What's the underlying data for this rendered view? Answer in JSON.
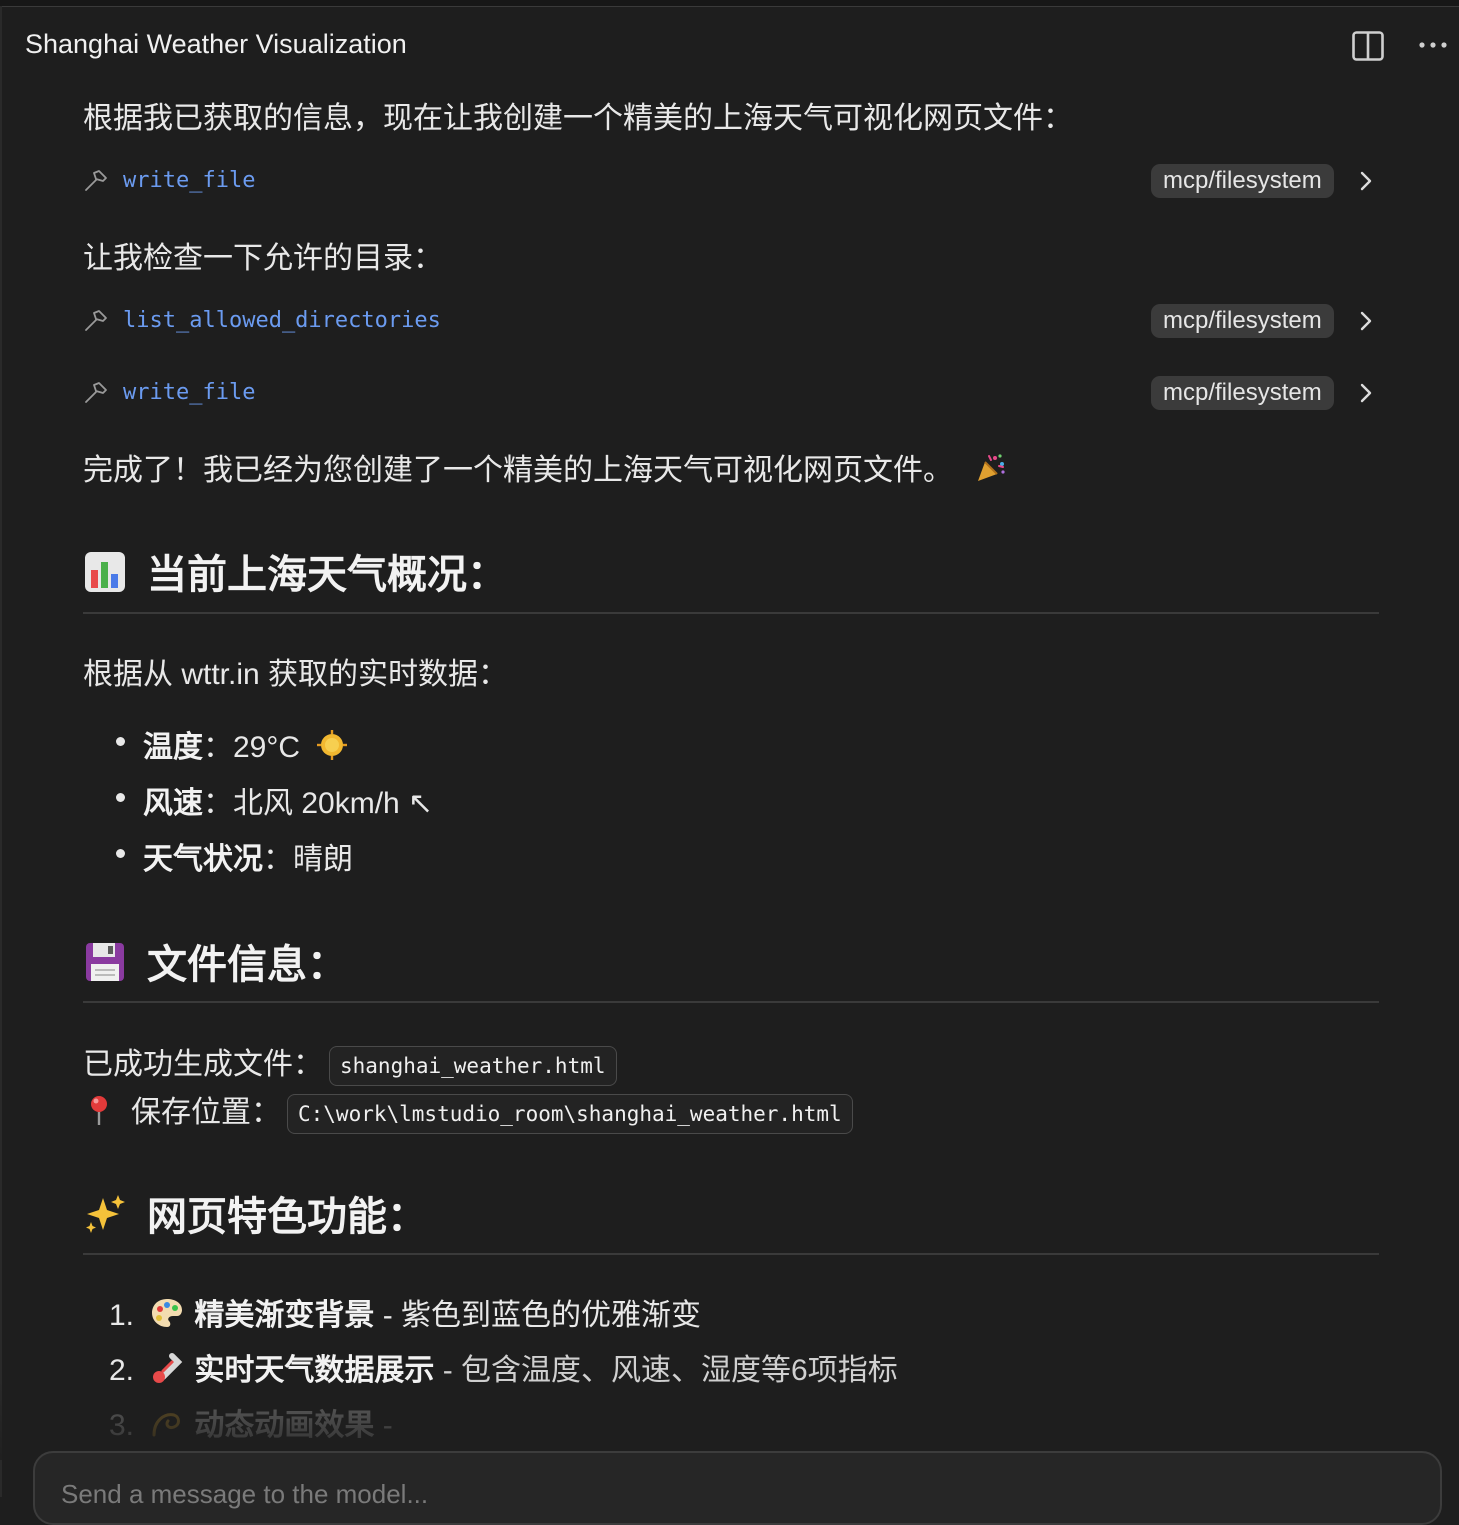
{
  "window": {
    "title": "Shanghai Weather Visualization"
  },
  "messages": {
    "intro": "根据我已获取的信息，现在让我创建一个精美的上海天气可视化网页文件：",
    "check_dirs": "让我检查一下允许的目录：",
    "done": "完成了！我已经为您创建了一个精美的上海天气可视化网页文件。",
    "done_emoji": "party-popper-icon"
  },
  "tool_calls": [
    {
      "name": "write_file",
      "source": "mcp/filesystem"
    },
    {
      "name": "list_allowed_directories",
      "source": "mcp/filesystem"
    },
    {
      "name": "write_file",
      "source": "mcp/filesystem"
    }
  ],
  "section_weather": {
    "icon": "bar-chart-icon",
    "heading": "当前上海天气概况：",
    "source_text": "根据从 wttr.in 获取的实时数据：",
    "items": [
      {
        "label": "温度",
        "sep": "：",
        "value": "29°C",
        "icon": "sun-icon"
      },
      {
        "label": "风速",
        "sep": "：",
        "value": "北风 20km/h ↖"
      },
      {
        "label": "天气状况",
        "sep": "：",
        "value": "晴朗"
      }
    ]
  },
  "section_file": {
    "icon": "floppy-disk-icon",
    "heading": "文件信息：",
    "generated_label": "已成功生成文件：",
    "filename": "shanghai_weather.html",
    "location_icon": "pushpin-icon",
    "location_label": "保存位置：",
    "path": "C:\\work\\lmstudio_room\\shanghai_weather.html"
  },
  "section_features": {
    "icon": "sparkles-icon",
    "heading": "网页特色功能：",
    "items": [
      {
        "num": "1.",
        "icon": "palette-icon",
        "title": "精美渐变背景",
        "desc": " - 紫色到蓝色的优雅渐变"
      },
      {
        "num": "2.",
        "icon": "thermometer-icon",
        "title": "实时天气数据展示",
        "desc": " - 包含温度、风速、湿度等6项指标"
      },
      {
        "num": "3.",
        "icon": "dizzy-icon",
        "title": "动态动画效果",
        "desc": " -"
      }
    ]
  },
  "composer": {
    "placeholder": "Send a message to the model..."
  },
  "colors": {
    "background": "#1e1e1e",
    "tool_name": "#6b9bf0",
    "badge_bg": "#3b3b3b"
  }
}
